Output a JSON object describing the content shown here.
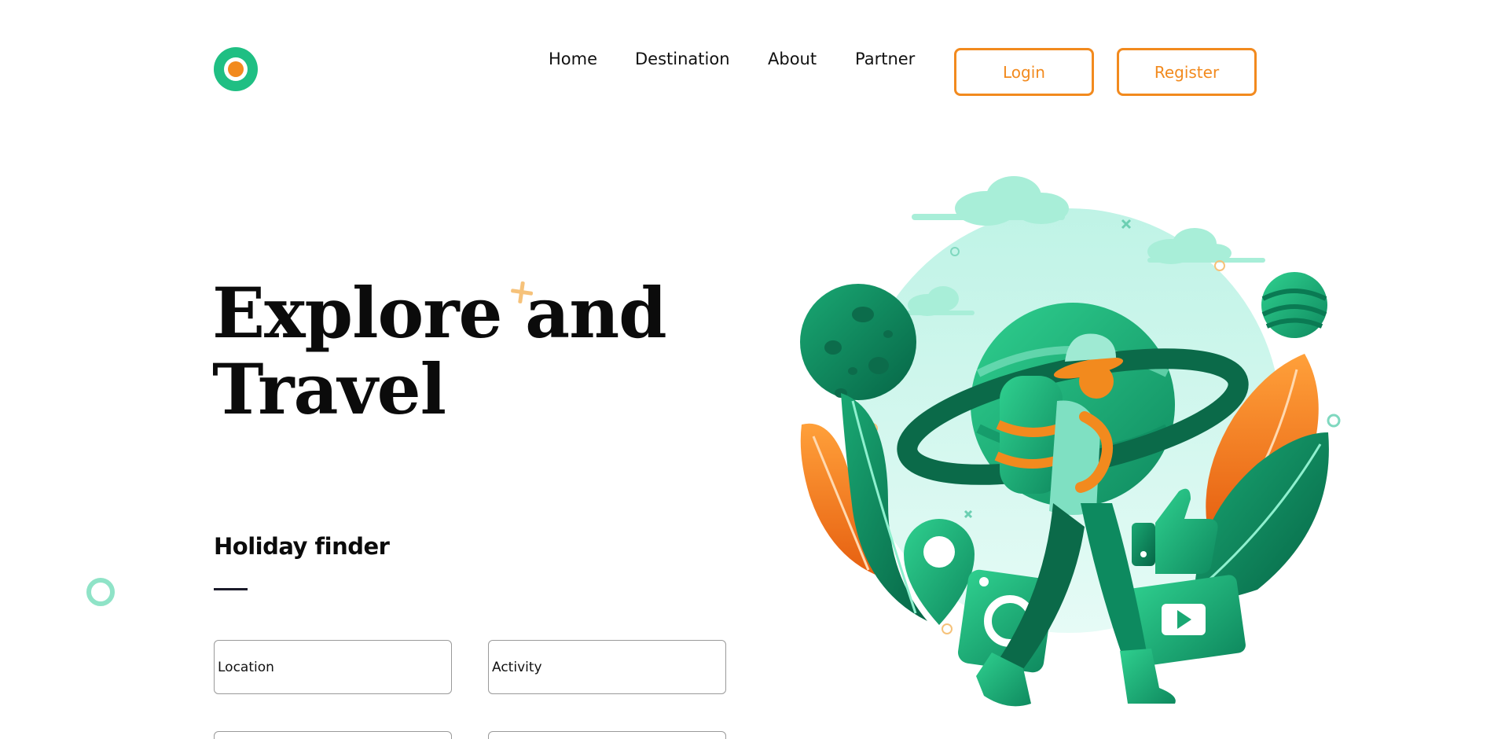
{
  "nav": {
    "items": [
      "Home",
      "Destination",
      "About",
      "Partner"
    ],
    "login_label": "Login",
    "register_label": "Register"
  },
  "hero": {
    "title_line1": "Explore and",
    "title_line2": "Travel"
  },
  "finder": {
    "title": "Holiday finder",
    "location_placeholder": "Location",
    "activity_placeholder": "Activity"
  },
  "colors": {
    "brand_green": "#1fbf83",
    "accent_orange": "#f28a1e",
    "light_mint": "#c9f5ea"
  },
  "icons": {
    "logo": "circle-logo-icon",
    "illustration": "traveler-planet-illustration"
  }
}
